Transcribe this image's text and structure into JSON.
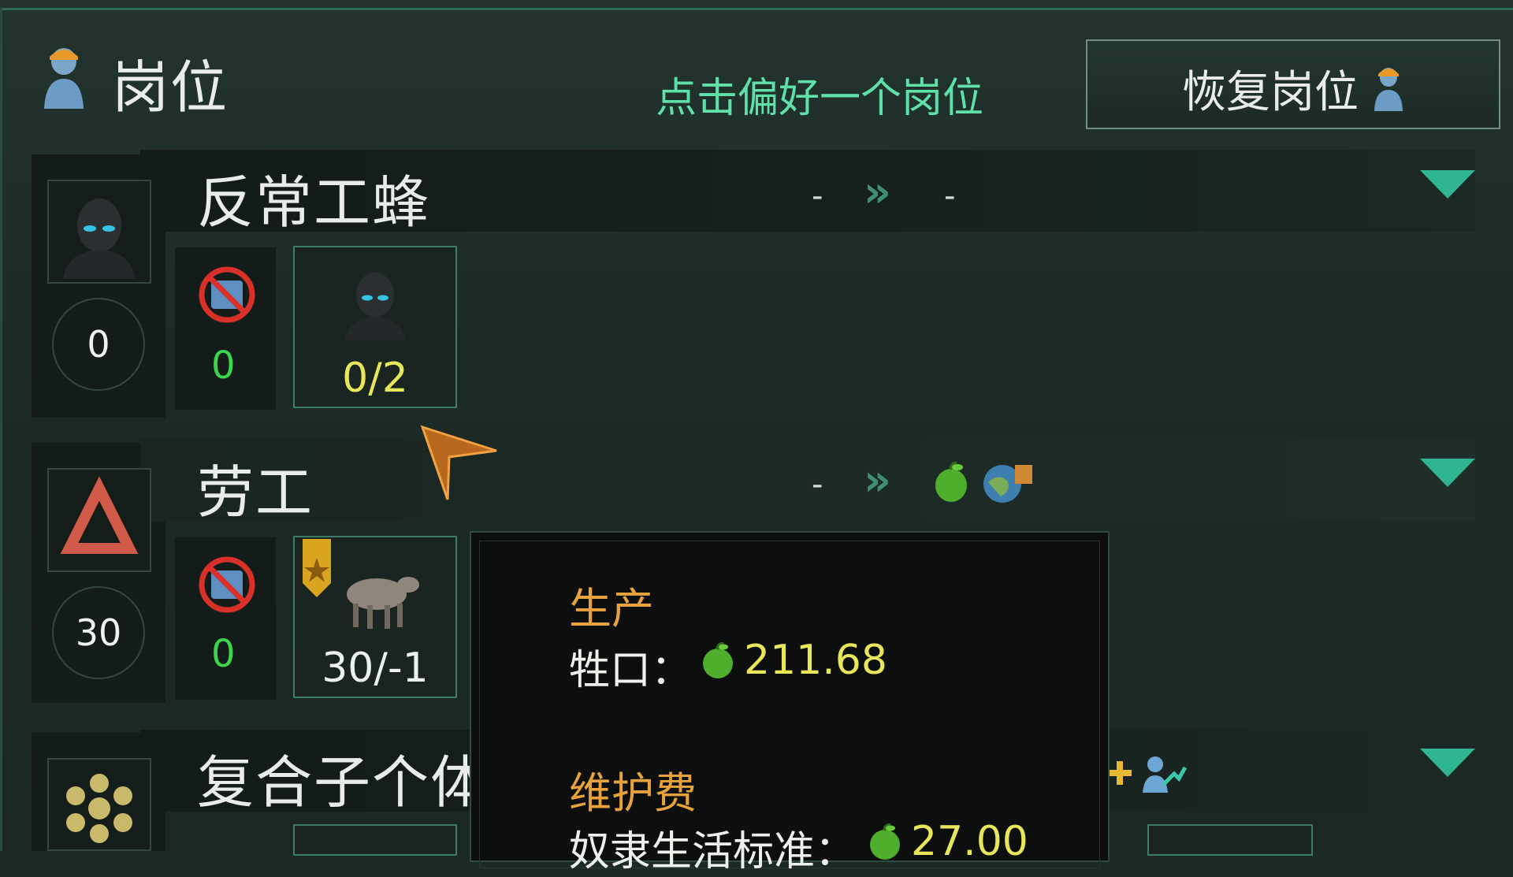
{
  "header": {
    "title": "岗位",
    "hint": "点击偏好一个岗位",
    "restore_label": "恢复岗位"
  },
  "jobs": [
    {
      "name": "反常工蜂",
      "count": "0",
      "unemployed": "0",
      "slot_value": "0/2",
      "from": "-",
      "to": "-"
    },
    {
      "name": "劳工",
      "count": "30",
      "unemployed": "0",
      "slot_value": "30/-1",
      "from": "-"
    },
    {
      "name": "复合子个体"
    }
  ],
  "tooltip": {
    "production_title": "生产",
    "production_label": "牲口：",
    "production_value": "211.68",
    "upkeep_title": "维护费",
    "upkeep_label": "奴隶生活标准：",
    "upkeep_value": "27.00"
  },
  "colors": {
    "accent_green": "#5fe0a8",
    "zero_green": "#3bd64d",
    "yellow_value": "#e8e65a",
    "orange_title": "#e7a23c",
    "triangle_teal": "#2fb592"
  }
}
